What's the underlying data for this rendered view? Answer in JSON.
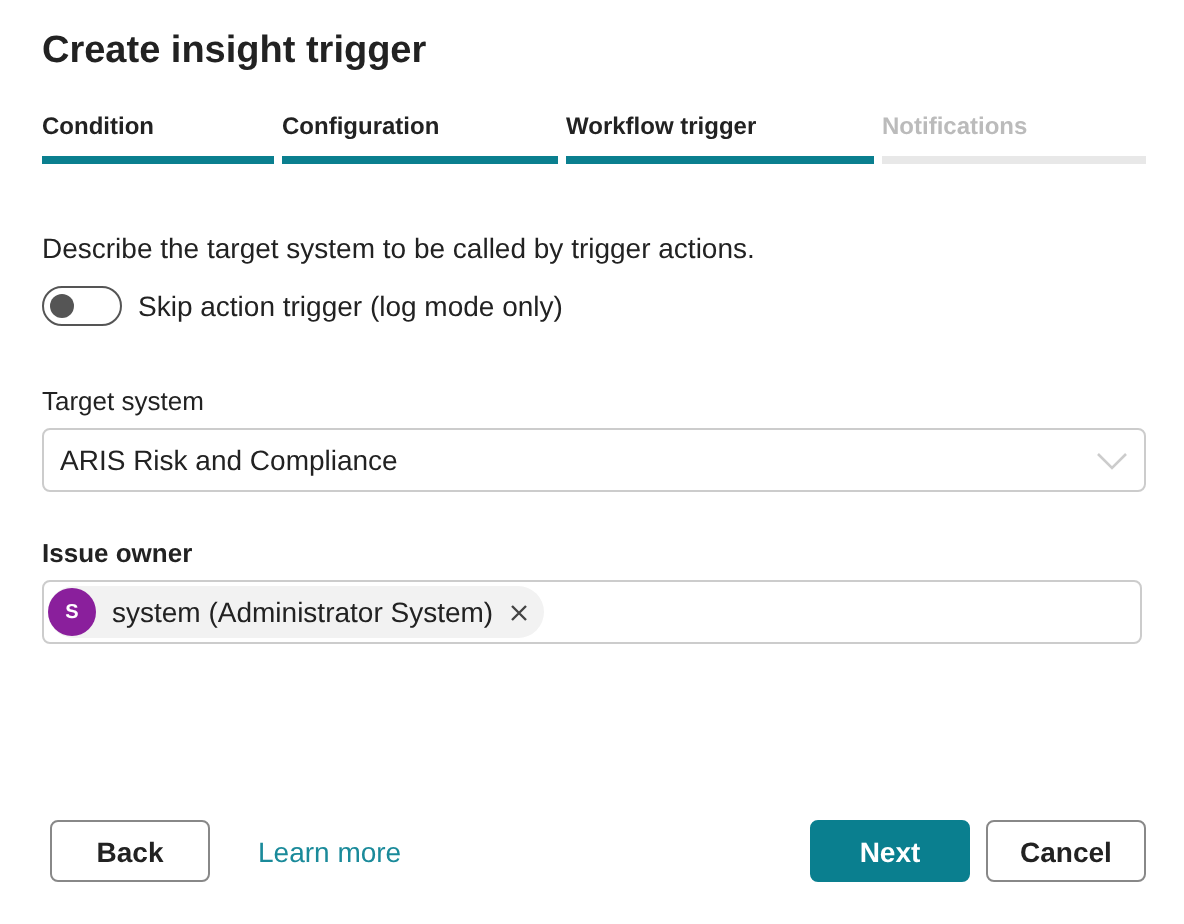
{
  "title": "Create insight trigger",
  "steps": [
    {
      "label": "Condition",
      "done": true
    },
    {
      "label": "Configuration",
      "done": true
    },
    {
      "label": "Workflow trigger",
      "done": true
    },
    {
      "label": "Notifications",
      "done": false
    }
  ],
  "description": "Describe the target system to be called by trigger actions.",
  "skip_toggle": {
    "label": "Skip action trigger (log mode only)",
    "on": false
  },
  "target_system": {
    "label": "Target system",
    "value": "ARIS Risk and Compliance"
  },
  "issue_owner": {
    "label": "Issue owner",
    "chips": [
      {
        "initial": "S",
        "text": "system (Administrator System)",
        "color": "#8a1f9c"
      }
    ]
  },
  "buttons": {
    "back": "Back",
    "learn_more": "Learn more",
    "next": "Next",
    "cancel": "Cancel"
  }
}
